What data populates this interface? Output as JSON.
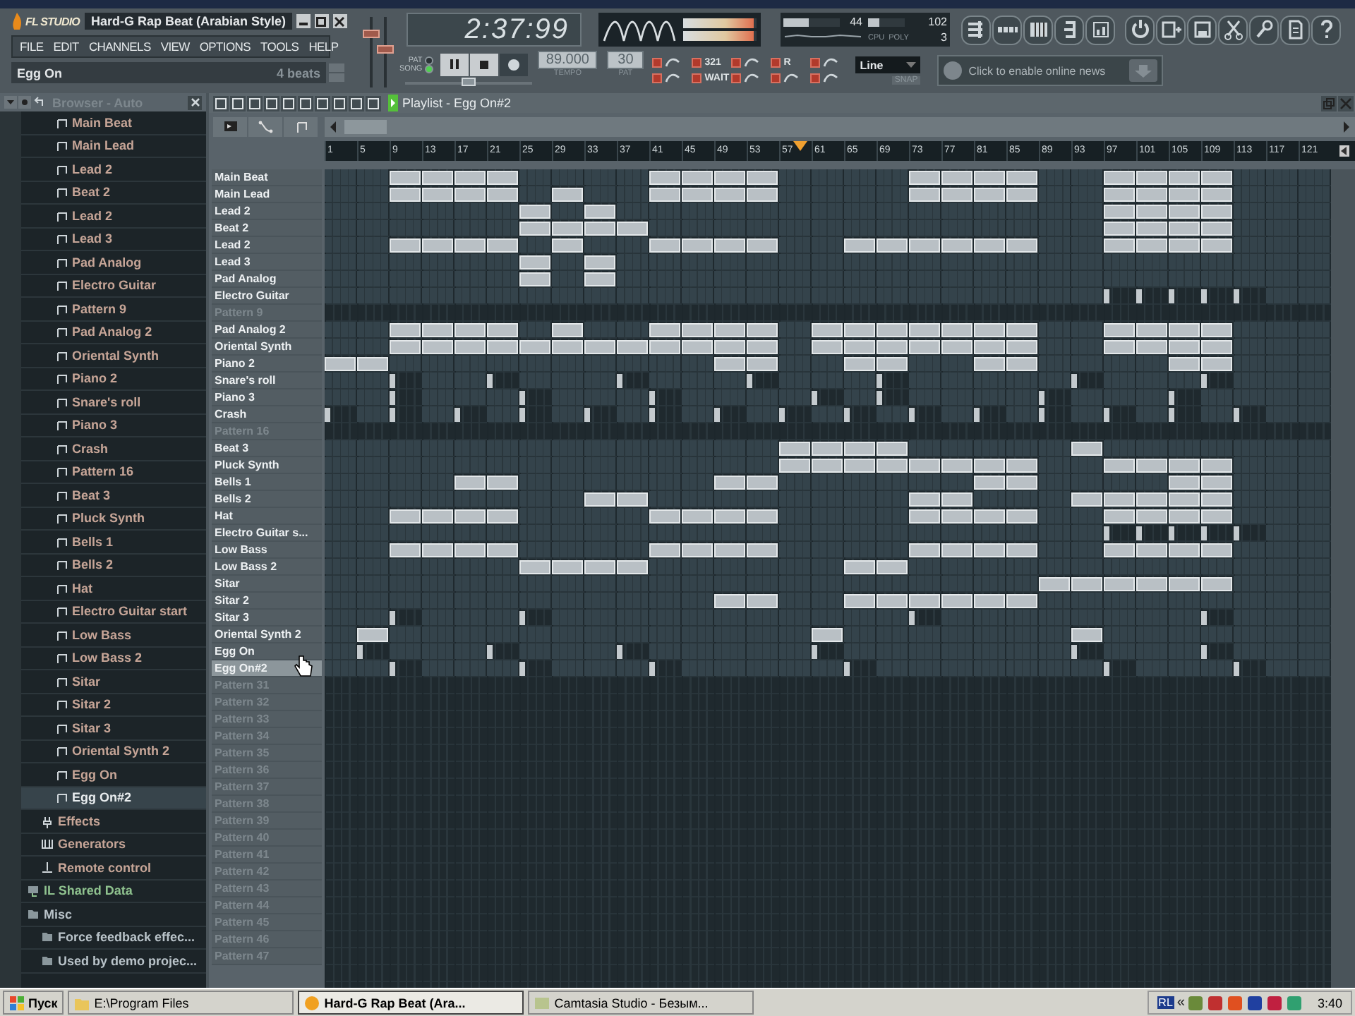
{
  "app": {
    "logo": "FL STUDIO",
    "title": "Hard-G Rap Beat (Arabian Style)"
  },
  "menu": [
    "FILE",
    "EDIT",
    "CHANNELS",
    "VIEW",
    "OPTIONS",
    "TOOLS",
    "HELP"
  ],
  "hint": {
    "text": "Egg On",
    "detail": "4 beats"
  },
  "faders": [
    {
      "level": 0.8
    },
    {
      "level": 0.55
    }
  ],
  "time": "2:37:99",
  "modes": [
    {
      "label": "PAT",
      "selected": false
    },
    {
      "label": "SONG",
      "selected": true
    }
  ],
  "song_position": {
    "level": 0.5
  },
  "tempo": {
    "value": "89.000",
    "label": "TEMPO"
  },
  "pattern": {
    "value": "30",
    "label": "PAT"
  },
  "output_meter": [
    {
      "level": 0.97
    },
    {
      "level": 0.97
    }
  ],
  "cpu": {
    "cpu_value": "44",
    "memory_value": "102",
    "poly_value": "3",
    "cpu_label": "CPU",
    "poly_label": "POLY"
  },
  "cpu_meter": {
    "level": 0.44
  },
  "memory_meter": {
    "level": 0.3
  },
  "toggle_labels": {
    "countdown": "321",
    "wait": "WAIT",
    "record": "R"
  },
  "snap": {
    "value": "Line",
    "label": "SNAP"
  },
  "news": {
    "text": "Click to enable online news"
  },
  "browser": {
    "title": "Browser - Auto",
    "tree": [
      {
        "children": [
          {
            "children": [
              {
                "label": "Main Beat",
                "kind": "pattern",
                "selected": false
              },
              {
                "label": "Main Lead",
                "kind": "pattern",
                "selected": false
              },
              {
                "label": "Lead 2",
                "kind": "pattern",
                "selected": false
              },
              {
                "label": "Beat 2",
                "kind": "pattern",
                "selected": false
              },
              {
                "label": "Lead 2",
                "kind": "pattern",
                "selected": false
              },
              {
                "label": "Lead 3",
                "kind": "pattern",
                "selected": false
              },
              {
                "label": "Pad Analog",
                "kind": "pattern",
                "selected": false
              },
              {
                "label": "Electro Guitar",
                "kind": "pattern",
                "selected": false
              },
              {
                "label": "Pattern 9",
                "kind": "pattern",
                "selected": false
              },
              {
                "label": "Pad Analog 2",
                "kind": "pattern",
                "selected": false
              },
              {
                "label": "Oriental Synth",
                "kind": "pattern",
                "selected": false
              },
              {
                "label": "Piano 2",
                "kind": "pattern",
                "selected": false
              },
              {
                "label": "Snare's roll",
                "kind": "pattern",
                "selected": false
              },
              {
                "label": "Piano 3",
                "kind": "pattern",
                "selected": false
              },
              {
                "label": "Crash",
                "kind": "pattern",
                "selected": false
              },
              {
                "label": "Pattern 16",
                "kind": "pattern",
                "selected": false
              },
              {
                "label": "Beat 3",
                "kind": "pattern",
                "selected": false
              },
              {
                "label": "Pluck Synth",
                "kind": "pattern",
                "selected": false
              },
              {
                "label": "Bells 1",
                "kind": "pattern",
                "selected": false
              },
              {
                "label": "Bells 2",
                "kind": "pattern",
                "selected": false
              },
              {
                "label": "Hat",
                "kind": "pattern",
                "selected": false
              },
              {
                "label": "Electro Guitar start",
                "kind": "pattern",
                "selected": false
              },
              {
                "label": "Low Bass",
                "kind": "pattern",
                "selected": false
              },
              {
                "label": "Low Bass 2",
                "kind": "pattern",
                "selected": false
              },
              {
                "label": "Sitar",
                "kind": "pattern",
                "selected": false
              },
              {
                "label": "Sitar 2",
                "kind": "pattern",
                "selected": false
              },
              {
                "label": "Sitar 3",
                "kind": "pattern",
                "selected": false
              },
              {
                "label": "Oriental Synth 2",
                "kind": "pattern",
                "selected": false
              },
              {
                "label": "Egg On",
                "kind": "pattern",
                "selected": false
              },
              {
                "label": "Egg On#2",
                "kind": "pattern",
                "selected": true
              }
            ]
          },
          {
            "label": "Effects",
            "kind": "effects",
            "selected": false
          },
          {
            "label": "Generators",
            "kind": "generators",
            "selected": false
          },
          {
            "label": "Remote control",
            "kind": "remote",
            "selected": false
          }
        ]
      },
      {
        "label": "IL Shared Data",
        "kind": "shared",
        "selected": false
      },
      {
        "label": "Misc",
        "kind": "folder",
        "selected": false,
        "children": [
          {
            "label": "Force feedback effec...",
            "kind": "folder",
            "selected": false
          },
          {
            "label": "Used by demo projec...",
            "kind": "folder",
            "selected": false
          }
        ]
      }
    ]
  },
  "playlist": {
    "title": "Playlist - Egg On#2",
    "ruler": [
      "1",
      "5",
      "9",
      "13",
      "17",
      "21",
      "25",
      "29",
      "33",
      "37",
      "41",
      "45",
      "49",
      "53",
      "57",
      "61",
      "65",
      "69",
      "73",
      "77",
      "81",
      "85",
      "89",
      "93",
      "97",
      "101",
      "105",
      "109",
      "113",
      "117",
      "121"
    ],
    "playhead": {
      "level": 0.47
    },
    "tracks": [
      {
        "name": "Main Beat",
        "dimmed": false,
        "selected": false,
        "kind": "long",
        "cells": [
          false,
          false,
          true,
          true,
          true,
          true,
          false,
          false,
          false,
          false,
          true,
          true,
          true,
          true,
          false,
          false,
          false,
          false,
          true,
          true,
          true,
          true,
          false,
          false,
          true,
          true,
          true,
          true,
          false,
          false,
          false
        ]
      },
      {
        "name": "Main Lead",
        "dimmed": false,
        "selected": false,
        "kind": "long",
        "cells": [
          false,
          false,
          true,
          true,
          true,
          true,
          false,
          true,
          false,
          false,
          true,
          true,
          true,
          true,
          false,
          false,
          false,
          false,
          true,
          true,
          true,
          true,
          false,
          false,
          true,
          true,
          true,
          true,
          false,
          false,
          false
        ]
      },
      {
        "name": "Lead 2",
        "dimmed": false,
        "selected": false,
        "kind": "long",
        "cells": [
          false,
          false,
          false,
          false,
          false,
          false,
          true,
          false,
          true,
          false,
          false,
          false,
          false,
          false,
          false,
          false,
          false,
          false,
          false,
          false,
          false,
          false,
          false,
          false,
          true,
          true,
          true,
          true,
          false,
          false,
          false
        ]
      },
      {
        "name": "Beat 2",
        "dimmed": false,
        "selected": false,
        "kind": "long",
        "cells": [
          false,
          false,
          false,
          false,
          false,
          false,
          true,
          true,
          true,
          true,
          false,
          false,
          false,
          false,
          false,
          false,
          false,
          false,
          false,
          false,
          false,
          false,
          false,
          false,
          true,
          true,
          true,
          true,
          false,
          false,
          false
        ]
      },
      {
        "name": "Lead 2",
        "dimmed": false,
        "selected": false,
        "kind": "long",
        "cells": [
          false,
          false,
          true,
          true,
          true,
          true,
          false,
          true,
          false,
          false,
          true,
          true,
          true,
          true,
          false,
          false,
          true,
          true,
          true,
          true,
          true,
          true,
          false,
          false,
          true,
          true,
          true,
          true,
          false,
          false,
          false
        ]
      },
      {
        "name": "Lead 3",
        "dimmed": false,
        "selected": false,
        "kind": "long",
        "cells": [
          false,
          false,
          false,
          false,
          false,
          false,
          true,
          false,
          true,
          false,
          false,
          false,
          false,
          false,
          false,
          false,
          false,
          false,
          false,
          false,
          false,
          false,
          false,
          false,
          false,
          false,
          false,
          false,
          false,
          false,
          false
        ]
      },
      {
        "name": "Pad Analog",
        "dimmed": false,
        "selected": false,
        "kind": "long",
        "cells": [
          false,
          false,
          false,
          false,
          false,
          false,
          true,
          false,
          true,
          false,
          false,
          false,
          false,
          false,
          false,
          false,
          false,
          false,
          false,
          false,
          false,
          false,
          false,
          false,
          false,
          false,
          false,
          false,
          false,
          false,
          false
        ]
      },
      {
        "name": "Electro Guitar",
        "dimmed": false,
        "selected": false,
        "kind": "short",
        "cells": [
          false,
          false,
          false,
          false,
          false,
          false,
          false,
          false,
          false,
          false,
          false,
          false,
          false,
          false,
          false,
          false,
          false,
          false,
          false,
          false,
          false,
          false,
          false,
          false,
          true,
          true,
          true,
          true,
          true,
          false,
          false
        ]
      },
      {
        "name": "Pattern 9",
        "dimmed": true,
        "selected": false
      },
      {
        "name": "Pad Analog 2",
        "dimmed": false,
        "selected": false,
        "kind": "long",
        "cells": [
          false,
          false,
          true,
          true,
          true,
          true,
          false,
          true,
          false,
          false,
          true,
          true,
          true,
          true,
          false,
          true,
          true,
          true,
          true,
          true,
          true,
          true,
          false,
          false,
          true,
          true,
          true,
          true,
          false,
          false,
          false
        ]
      },
      {
        "name": "Oriental Synth",
        "dimmed": false,
        "selected": false,
        "kind": "long",
        "cells": [
          false,
          false,
          true,
          true,
          true,
          true,
          true,
          true,
          true,
          true,
          true,
          true,
          true,
          true,
          false,
          true,
          true,
          true,
          true,
          true,
          true,
          true,
          false,
          false,
          true,
          true,
          true,
          true,
          false,
          false,
          false
        ]
      },
      {
        "name": "Piano 2",
        "dimmed": false,
        "selected": false,
        "kind": "long",
        "cells": [
          true,
          true,
          false,
          false,
          false,
          false,
          false,
          false,
          false,
          false,
          false,
          false,
          true,
          true,
          false,
          false,
          true,
          true,
          false,
          false,
          true,
          true,
          false,
          false,
          false,
          false,
          true,
          true,
          false,
          false,
          false
        ]
      },
      {
        "name": "Snare's roll",
        "dimmed": false,
        "selected": false,
        "kind": "short",
        "cells": [
          false,
          false,
          true,
          false,
          false,
          true,
          false,
          false,
          false,
          true,
          false,
          false,
          false,
          true,
          false,
          false,
          false,
          true,
          false,
          false,
          false,
          false,
          false,
          true,
          false,
          false,
          false,
          true,
          false,
          false,
          false
        ]
      },
      {
        "name": "Piano 3",
        "dimmed": false,
        "selected": false,
        "kind": "short",
        "cells": [
          false,
          false,
          true,
          false,
          false,
          false,
          true,
          false,
          false,
          false,
          true,
          false,
          false,
          false,
          false,
          true,
          false,
          true,
          false,
          false,
          false,
          false,
          true,
          false,
          false,
          false,
          true,
          false,
          false,
          false,
          false
        ]
      },
      {
        "name": "Crash",
        "dimmed": false,
        "selected": false,
        "kind": "short",
        "cells": [
          true,
          false,
          true,
          false,
          true,
          false,
          true,
          false,
          true,
          false,
          true,
          false,
          true,
          false,
          true,
          false,
          true,
          false,
          true,
          false,
          true,
          false,
          true,
          false,
          true,
          false,
          true,
          false,
          true,
          false,
          false
        ]
      },
      {
        "name": "Pattern 16",
        "dimmed": true,
        "selected": false
      },
      {
        "name": "Beat 3",
        "dimmed": false,
        "selected": false,
        "kind": "long",
        "cells": [
          false,
          false,
          false,
          false,
          false,
          false,
          false,
          false,
          false,
          false,
          false,
          false,
          false,
          false,
          true,
          true,
          true,
          true,
          false,
          false,
          false,
          false,
          false,
          true,
          false,
          false,
          false,
          false,
          false,
          false,
          false
        ]
      },
      {
        "name": "Pluck Synth",
        "dimmed": false,
        "selected": false,
        "kind": "long",
        "cells": [
          false,
          false,
          false,
          false,
          false,
          false,
          false,
          false,
          false,
          false,
          false,
          false,
          false,
          false,
          true,
          true,
          true,
          true,
          true,
          true,
          true,
          true,
          false,
          false,
          true,
          true,
          true,
          true,
          false,
          false,
          false
        ]
      },
      {
        "name": "Bells 1",
        "dimmed": false,
        "selected": false,
        "kind": "long",
        "cells": [
          false,
          false,
          false,
          false,
          true,
          true,
          false,
          false,
          false,
          false,
          false,
          false,
          true,
          true,
          false,
          false,
          false,
          false,
          false,
          false,
          true,
          true,
          false,
          false,
          false,
          false,
          true,
          true,
          false,
          false,
          false
        ]
      },
      {
        "name": "Bells 2",
        "dimmed": false,
        "selected": false,
        "kind": "long",
        "cells": [
          false,
          false,
          false,
          false,
          false,
          false,
          false,
          false,
          true,
          true,
          false,
          false,
          false,
          false,
          false,
          false,
          false,
          false,
          true,
          true,
          false,
          false,
          false,
          true,
          true,
          true,
          true,
          true,
          false,
          false,
          false
        ]
      },
      {
        "name": "Hat",
        "dimmed": false,
        "selected": false,
        "kind": "long",
        "cells": [
          false,
          false,
          true,
          true,
          true,
          true,
          false,
          false,
          false,
          false,
          true,
          true,
          true,
          true,
          false,
          false,
          false,
          false,
          true,
          true,
          true,
          true,
          false,
          false,
          true,
          true,
          true,
          true,
          false,
          false,
          false
        ]
      },
      {
        "name": "Electro Guitar s...",
        "dimmed": false,
        "selected": false,
        "kind": "short",
        "cells": [
          false,
          false,
          false,
          false,
          false,
          false,
          false,
          false,
          false,
          false,
          false,
          false,
          false,
          false,
          false,
          false,
          false,
          false,
          false,
          false,
          false,
          false,
          false,
          false,
          true,
          true,
          true,
          true,
          true,
          false,
          false
        ]
      },
      {
        "name": "Low Bass",
        "dimmed": false,
        "selected": false,
        "kind": "long",
        "cells": [
          false,
          false,
          true,
          true,
          true,
          true,
          false,
          false,
          false,
          false,
          true,
          true,
          true,
          true,
          false,
          false,
          false,
          false,
          true,
          true,
          true,
          true,
          false,
          false,
          true,
          true,
          true,
          true,
          false,
          false,
          false
        ]
      },
      {
        "name": "Low Bass 2",
        "dimmed": false,
        "selected": false,
        "kind": "long",
        "cells": [
          false,
          false,
          false,
          false,
          false,
          false,
          true,
          true,
          true,
          true,
          false,
          false,
          false,
          false,
          false,
          false,
          true,
          true,
          false,
          false,
          false,
          false,
          false,
          false,
          false,
          false,
          false,
          false,
          false,
          false,
          false
        ]
      },
      {
        "name": "Sitar",
        "dimmed": false,
        "selected": false,
        "kind": "long",
        "cells": [
          false,
          false,
          false,
          false,
          false,
          false,
          false,
          false,
          false,
          false,
          false,
          false,
          false,
          false,
          false,
          false,
          false,
          false,
          false,
          false,
          false,
          false,
          true,
          true,
          true,
          true,
          true,
          true,
          false,
          false,
          false
        ]
      },
      {
        "name": "Sitar 2",
        "dimmed": false,
        "selected": false,
        "kind": "long",
        "cells": [
          false,
          false,
          false,
          false,
          false,
          false,
          false,
          false,
          false,
          false,
          false,
          false,
          true,
          true,
          false,
          false,
          true,
          true,
          true,
          true,
          true,
          true,
          false,
          false,
          false,
          false,
          false,
          false,
          false,
          false,
          false
        ]
      },
      {
        "name": "Sitar 3",
        "dimmed": false,
        "selected": false,
        "kind": "short",
        "cells": [
          false,
          false,
          true,
          false,
          false,
          false,
          true,
          false,
          false,
          false,
          false,
          false,
          false,
          false,
          false,
          false,
          false,
          false,
          true,
          false,
          false,
          false,
          false,
          false,
          false,
          false,
          false,
          true,
          false,
          false,
          false
        ]
      },
      {
        "name": "Oriental Synth 2",
        "dimmed": false,
        "selected": false,
        "kind": "long",
        "cells": [
          false,
          true,
          false,
          false,
          false,
          false,
          false,
          false,
          false,
          false,
          false,
          false,
          false,
          false,
          false,
          true,
          false,
          false,
          false,
          false,
          false,
          false,
          false,
          true,
          false,
          false,
          false,
          false,
          false,
          false,
          false
        ]
      },
      {
        "name": "Egg On",
        "dimmed": false,
        "selected": false,
        "kind": "short",
        "cells": [
          false,
          true,
          false,
          false,
          false,
          true,
          false,
          false,
          false,
          true,
          false,
          false,
          false,
          false,
          false,
          true,
          false,
          false,
          false,
          false,
          false,
          false,
          false,
          true,
          false,
          false,
          false,
          true,
          false,
          false,
          false
        ]
      },
      {
        "name": "Egg On#2",
        "dimmed": false,
        "selected": true,
        "kind": "short",
        "cells": [
          false,
          false,
          true,
          false,
          false,
          false,
          true,
          false,
          false,
          false,
          true,
          false,
          false,
          false,
          false,
          false,
          true,
          false,
          false,
          false,
          false,
          false,
          false,
          false,
          true,
          false,
          false,
          false,
          true,
          false,
          false
        ]
      },
      {
        "name": "Pattern 31",
        "dimmed": true,
        "selected": false
      },
      {
        "name": "Pattern 32",
        "dimmed": true,
        "selected": false
      },
      {
        "name": "Pattern 33",
        "dimmed": true,
        "selected": false
      },
      {
        "name": "Pattern 34",
        "dimmed": true,
        "selected": false
      },
      {
        "name": "Pattern 35",
        "dimmed": true,
        "selected": false
      },
      {
        "name": "Pattern 36",
        "dimmed": true,
        "selected": false
      },
      {
        "name": "Pattern 37",
        "dimmed": true,
        "selected": false
      },
      {
        "name": "Pattern 38",
        "dimmed": true,
        "selected": false
      },
      {
        "name": "Pattern 39",
        "dimmed": true,
        "selected": false
      },
      {
        "name": "Pattern 40",
        "dimmed": true,
        "selected": false
      },
      {
        "name": "Pattern 41",
        "dimmed": true,
        "selected": false
      },
      {
        "name": "Pattern 42",
        "dimmed": true,
        "selected": false
      },
      {
        "name": "Pattern 43",
        "dimmed": true,
        "selected": false
      },
      {
        "name": "Pattern 44",
        "dimmed": true,
        "selected": false
      },
      {
        "name": "Pattern 45",
        "dimmed": true,
        "selected": false
      },
      {
        "name": "Pattern 46",
        "dimmed": true,
        "selected": false
      },
      {
        "name": "Pattern 47",
        "dimmed": true,
        "selected": false
      }
    ]
  },
  "taskbar": {
    "start": "Пуск",
    "tasks": [
      {
        "label": "E:\\Program Files",
        "selected": false
      },
      {
        "label": "Hard-G Rap Beat (Ara...",
        "selected": true
      },
      {
        "label": "Camtasia Studio - Безым...",
        "selected": false
      }
    ],
    "tray_label": "RL",
    "tray_expand": "«",
    "clock": "3:40"
  }
}
